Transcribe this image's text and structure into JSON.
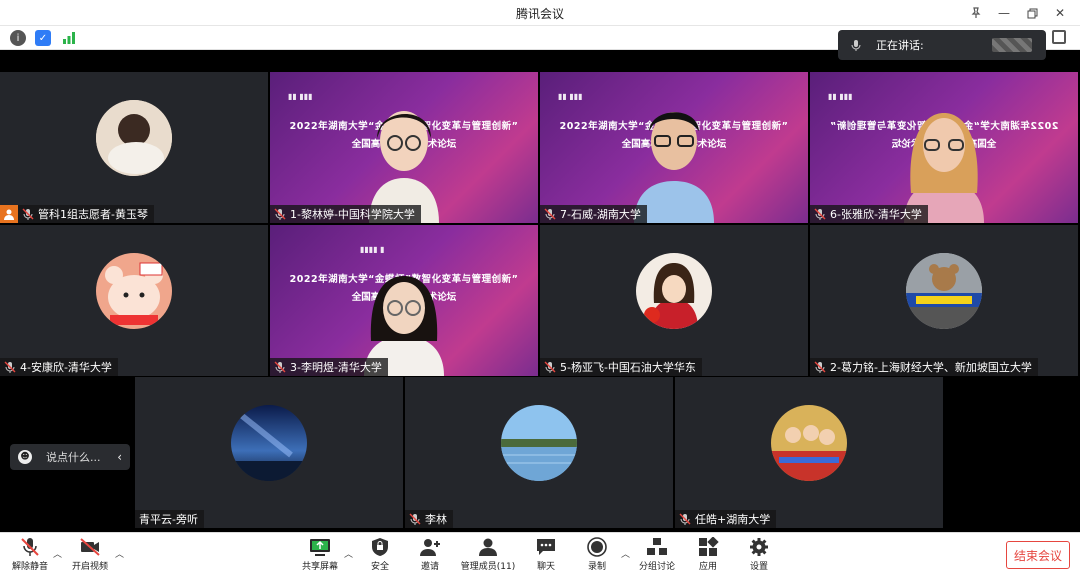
{
  "window": {
    "title": "腾讯会议"
  },
  "speaking": {
    "label": "正在讲话:"
  },
  "tiles": [
    {
      "name": "管科1组志愿者-黄玉琴",
      "kind": "avatar"
    },
    {
      "name": "1-黎林婷-中国科学院大学",
      "kind": "video"
    },
    {
      "name": "7-石威-湖南大学",
      "kind": "video"
    },
    {
      "name": "6-张雅欣-清华大学",
      "kind": "video"
    },
    {
      "name": "4-安康欣-清华大学",
      "kind": "avatar"
    },
    {
      "name": "3-李明煜-清华大学",
      "kind": "video"
    },
    {
      "name": "5-杨亚飞-中国石油大学华东",
      "kind": "avatar"
    },
    {
      "name": "2-葛力铭-上海财经大学、新加坡国立大学",
      "kind": "avatar"
    },
    {
      "name": "青平云-旁听",
      "kind": "avatar"
    },
    {
      "name": "李林",
      "kind": "avatar"
    },
    {
      "name": "任皓+湖南大学",
      "kind": "avatar"
    }
  ],
  "banner": {
    "line1": "2022年湖南大学“金蝶杯”数智化变革与管理创新”",
    "line2": "全国高校博士生学术论坛"
  },
  "chat": {
    "placeholder": "说点什么..."
  },
  "toolbar": {
    "unmute": "解除静音",
    "start_video": "开启视频",
    "share_screen": "共享屏幕",
    "security": "安全",
    "invite": "邀请",
    "manage_members": "管理成员(11)",
    "chat": "聊天",
    "record": "录制",
    "breakout": "分组讨论",
    "apps": "应用",
    "settings": "设置",
    "end_meeting": "结束会议"
  },
  "colors": {
    "end": "#e6463f",
    "tile_bg": "#24262b",
    "volunteer": "#e8731f"
  }
}
